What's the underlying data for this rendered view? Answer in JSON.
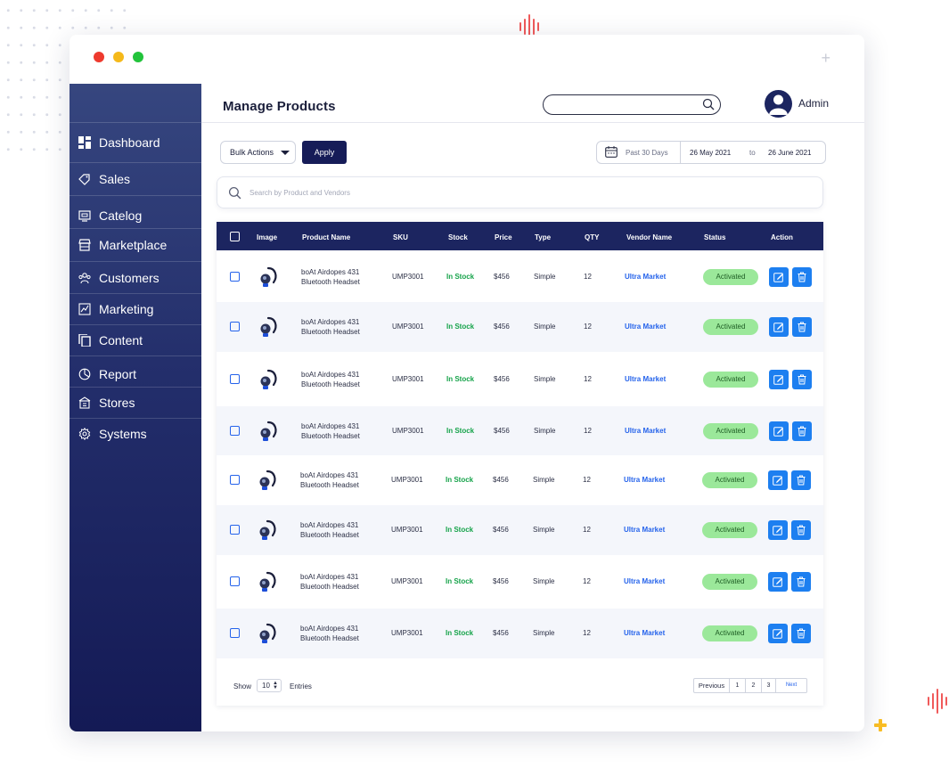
{
  "page": {
    "title": "Manage Products"
  },
  "user": {
    "name": "Admin"
  },
  "sidebar": {
    "items": [
      {
        "label": "Dashboard",
        "icon": "dashboard-icon"
      },
      {
        "label": "Sales",
        "icon": "tag-icon"
      },
      {
        "label": "Catelog",
        "icon": "catalog-icon"
      },
      {
        "label": "Marketplace",
        "icon": "store-icon"
      },
      {
        "label": "Customers",
        "icon": "users-icon"
      },
      {
        "label": "Marketing",
        "icon": "chart-icon"
      },
      {
        "label": "Content",
        "icon": "copy-icon"
      },
      {
        "label": "Report",
        "icon": "report-icon"
      },
      {
        "label": "Stores",
        "icon": "building-icon"
      },
      {
        "label": "Systems",
        "icon": "gear-icon"
      }
    ]
  },
  "toolbar": {
    "bulk_actions": "Bulk Actions",
    "apply": "Apply",
    "date_preset": "Past 30 Days",
    "date_from": "26 May 2021",
    "date_to_label": "to",
    "date_to": "26 June 2021"
  },
  "search": {
    "placeholder": "Search by Product and Vendors"
  },
  "table": {
    "headers": [
      "Image",
      "Product Name",
      "SKU",
      "Stock",
      "Price",
      "Type",
      "QTY",
      "Vendor Name",
      "Status",
      "Action"
    ],
    "rows": [
      {
        "name_line1": "boAt Airdopes 431",
        "name_line2": "Bluetooth Headset",
        "sku": "UMP3001",
        "stock": "In Stock",
        "price": "$456",
        "type": "Simple",
        "qty": "12",
        "vendor": "Ultra Market",
        "status": "Activated"
      },
      {
        "name_line1": "boAt Airdopes 431",
        "name_line2": "Bluetooth Headset",
        "sku": "UMP3001",
        "stock": "In Stock",
        "price": "$456",
        "type": "Simple",
        "qty": "12",
        "vendor": "Ultra Market",
        "status": "Activated"
      },
      {
        "name_line1": "boAt Airdopes 431",
        "name_line2": "Bluetooth Headset",
        "sku": "UMP3001",
        "stock": "In Stock",
        "price": "$456",
        "type": "Simple",
        "qty": "12",
        "vendor": "Ultra Market",
        "status": "Activated"
      },
      {
        "name_line1": "boAt Airdopes 431",
        "name_line2": "Bluetooth Headset",
        "sku": "UMP3001",
        "stock": "In Stock",
        "price": "$456",
        "type": "Simple",
        "qty": "12",
        "vendor": "Ultra Market",
        "status": "Activated"
      },
      {
        "name_line1": "boAt Airdopes 431",
        "name_line2": "Bluetooth Headset",
        "sku": "UMP3001",
        "stock": "In Stock",
        "price": "$456",
        "type": "Simple",
        "qty": "12",
        "vendor": "Ultra Market",
        "status": "Activated"
      },
      {
        "name_line1": "boAt Airdopes 431",
        "name_line2": "Bluetooth Headset",
        "sku": "UMP3001",
        "stock": "In Stock",
        "price": "$456",
        "type": "Simple",
        "qty": "12",
        "vendor": "Ultra Market",
        "status": "Activated"
      },
      {
        "name_line1": "boAt Airdopes 431",
        "name_line2": "Bluetooth Headset",
        "sku": "UMP3001",
        "stock": "In Stock",
        "price": "$456",
        "type": "Simple",
        "qty": "12",
        "vendor": "Ultra Market",
        "status": "Activated"
      },
      {
        "name_line1": "boAt Airdopes 431",
        "name_line2": "Bluetooth Headset",
        "sku": "UMP3001",
        "stock": "In Stock",
        "price": "$456",
        "type": "Simple",
        "qty": "12",
        "vendor": "Ultra Market",
        "status": "Activated"
      }
    ]
  },
  "footer": {
    "show_label": "Show",
    "show_value": "10",
    "entries_label": "Entries",
    "pagination": [
      "Previous",
      "1",
      "2",
      "3",
      "Next"
    ]
  },
  "colors": {
    "sidebar_top": "#36467f",
    "sidebar_bottom": "#141a55",
    "table_header": "#1c2560",
    "in_stock": "#16a34a",
    "vendor_link": "#2563eb",
    "status_badge": "#9be89a",
    "action_button": "#1d7ff0",
    "apply_button": "#161c58"
  }
}
